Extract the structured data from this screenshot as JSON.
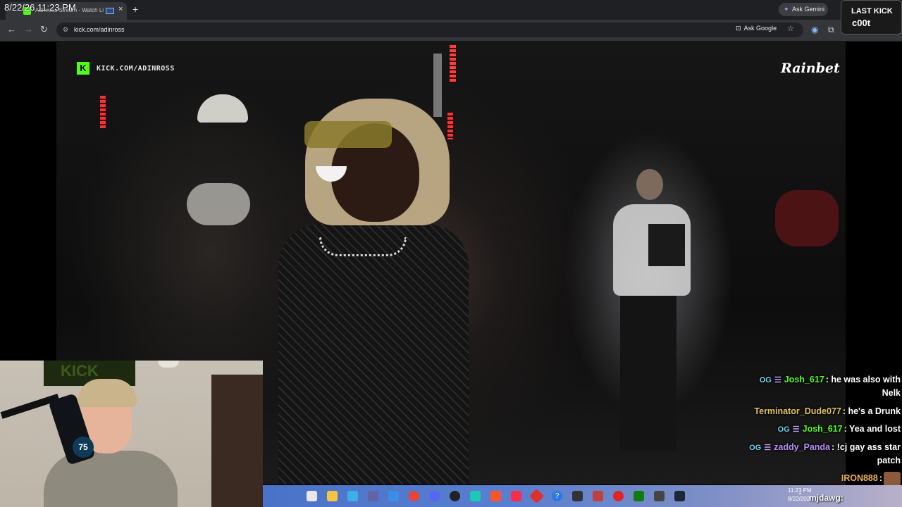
{
  "overlay_clock": "8/22/26 11:23 PM",
  "browser": {
    "tab_title": "Adinross Stream - Watch Li",
    "new_tab": "+",
    "tab_close": "×",
    "ask_gemini": "Ask Gemini",
    "url": "kick.com/adinross",
    "ask_google": "Ask Google"
  },
  "last_kick": {
    "label": "LAST KICK",
    "name": "c00t"
  },
  "video": {
    "kick_watermark": "KICK.COM/ADINROSS",
    "sponsor": "Rainbet"
  },
  "webcam": {
    "banner_text": "KICK",
    "mic_badge": "75"
  },
  "chat": {
    "messages": [
      {
        "user": "Josh_617",
        "user_color": "#53fc18",
        "badges": [
          "og",
          "sub"
        ],
        "text": "he was also with",
        "cont": "Nelk"
      },
      {
        "user": "Terminator_Dude077",
        "user_color": "#e6c35a",
        "badges": [],
        "text": "he's a Drunk"
      },
      {
        "user": "Josh_617",
        "user_color": "#53fc18",
        "badges": [
          "og",
          "sub"
        ],
        "text": "Yea and lost"
      },
      {
        "user": "zaddy_Panda",
        "user_color": "#b58ff5",
        "badges": [
          "og",
          "sub"
        ],
        "text": "!cj gay ass star",
        "cont": "patch"
      },
      {
        "user": "IRON888",
        "user_color": "#f0b34a",
        "badges": [],
        "text": ""
      }
    ],
    "bottom_user": "mjdawg:"
  },
  "taskbar": {
    "time": "11:23 PM",
    "date": "8/22/2026",
    "icons": [
      "windows-icon",
      "search-icon",
      "task-view-icon",
      "file-explorer-icon",
      "copilot-icon",
      "teams-icon",
      "store-icon",
      "chrome-icon",
      "discord-icon",
      "obs-icon",
      "app-icon",
      "brave-icon",
      "music-icon",
      "app-icon-2",
      "help-icon",
      "app-icon-3",
      "app-icon-4",
      "app-icon-5",
      "xbox-icon",
      "calculator-icon",
      "steam-icon"
    ]
  },
  "colors": {
    "kick_green": "#53fc18",
    "browser_dark": "#35363a",
    "taskbar_blue": "#4a72c8"
  }
}
